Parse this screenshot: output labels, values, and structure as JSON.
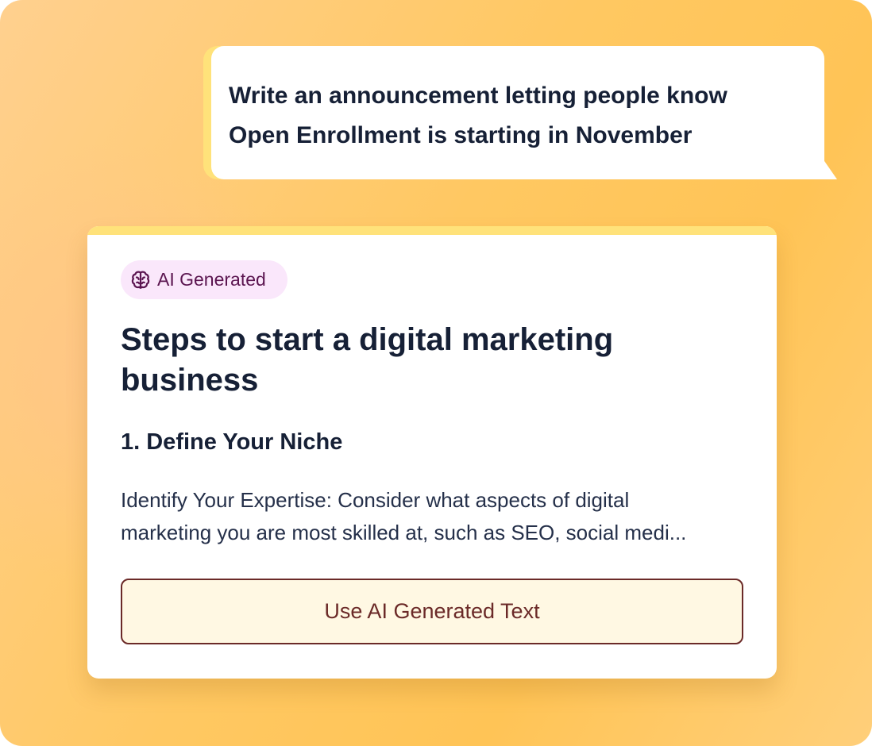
{
  "prompt_bubble": {
    "lines": [
      "Write an announcement letting people know",
      "Open Enrollment is starting in November"
    ]
  },
  "card": {
    "badge": {
      "icon": "brain-icon",
      "label": "AI Generated"
    },
    "title": "Steps to start a digital marketing business",
    "section_heading": "1. Define Your Niche",
    "body_lines": [
      "Identify Your Expertise: Consider what aspects of digital",
      "marketing you are most skilled at, such as SEO, social medi..."
    ],
    "action_button_label": "Use AI Generated Text"
  },
  "colors": {
    "background_start": "#ffd08f",
    "background_end": "#ffc456",
    "accent_yellow": "#ffe27a",
    "text_dark": "#162036",
    "badge_bg": "#fae7fb",
    "badge_text": "#5b1550",
    "button_bg": "#fff8e3",
    "button_border": "#6b2a28"
  }
}
